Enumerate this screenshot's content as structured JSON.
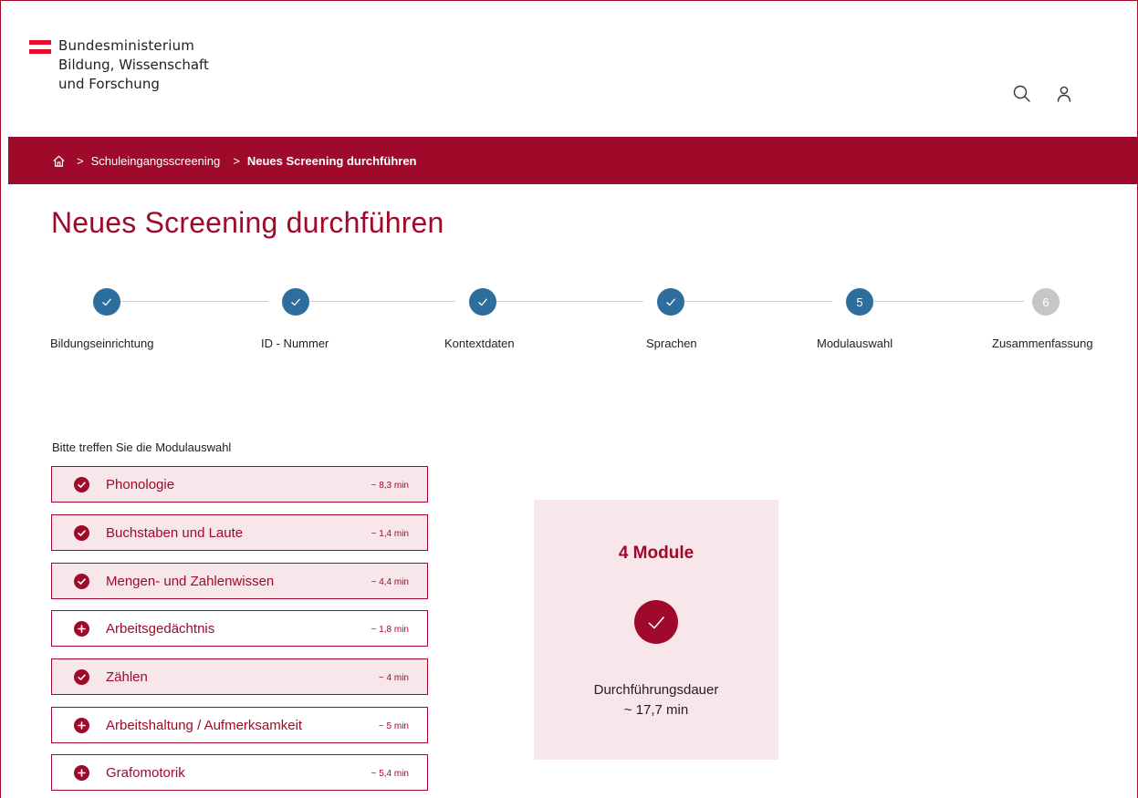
{
  "header": {
    "org_line1": "Bundesministerium",
    "org_line2": "Bildung, Wissenschaft",
    "org_line3": "und Forschung",
    "icons": [
      "flag-logo-icon",
      "search-icon",
      "user-icon"
    ],
    "flag_colors": [
      "#e30d2b",
      "#ffffff",
      "#e30d2b"
    ]
  },
  "breadcrumb": {
    "home_icon": "home-icon",
    "items": [
      "Schuleingangsscreening",
      "Neues Screening durchführen"
    ],
    "separator": ">"
  },
  "page": {
    "title": "Neues Screening durchführen"
  },
  "stepper": {
    "steps": [
      {
        "label": "Bildungseinrichtung",
        "state": "done",
        "number": ""
      },
      {
        "label": "ID - Nummer",
        "state": "done",
        "number": ""
      },
      {
        "label": "Kontextdaten",
        "state": "done",
        "number": ""
      },
      {
        "label": "Sprachen",
        "state": "done",
        "number": ""
      },
      {
        "label": "Modulauswahl",
        "state": "current",
        "number": "5"
      },
      {
        "label": "Zusammenfassung",
        "state": "upcoming",
        "number": "6"
      }
    ]
  },
  "modules": {
    "heading": "Bitte treffen Sie  die Modulauswahl",
    "items": [
      {
        "name": "Phonologie",
        "time": "~ 8,3 min",
        "selected": true
      },
      {
        "name": "Buchstaben und Laute",
        "time": "~ 1,4 min",
        "selected": true
      },
      {
        "name": "Mengen- und Zahlenwissen",
        "time": "~ 4,4 min",
        "selected": true
      },
      {
        "name": "Arbeitsgedächtnis",
        "time": "~ 1,8 min",
        "selected": false
      },
      {
        "name": "Zählen",
        "time": "~ 4 min",
        "selected": true
      },
      {
        "name": "Arbeitshaltung / Aufmerksamkeit",
        "time": "~ 5 min",
        "selected": false
      },
      {
        "name": "Grafomotorik",
        "time": "~ 5,4 min",
        "selected": false
      }
    ]
  },
  "summary": {
    "count": "4 Module",
    "duration_label": "Durchführungsdauer",
    "duration_value": "~ 17,7 min"
  },
  "colors": {
    "brand": "#a00a2a",
    "step_active": "#2d6e9c",
    "step_inactive": "#c6c6c6",
    "selected_bg": "#f7e6ea"
  }
}
